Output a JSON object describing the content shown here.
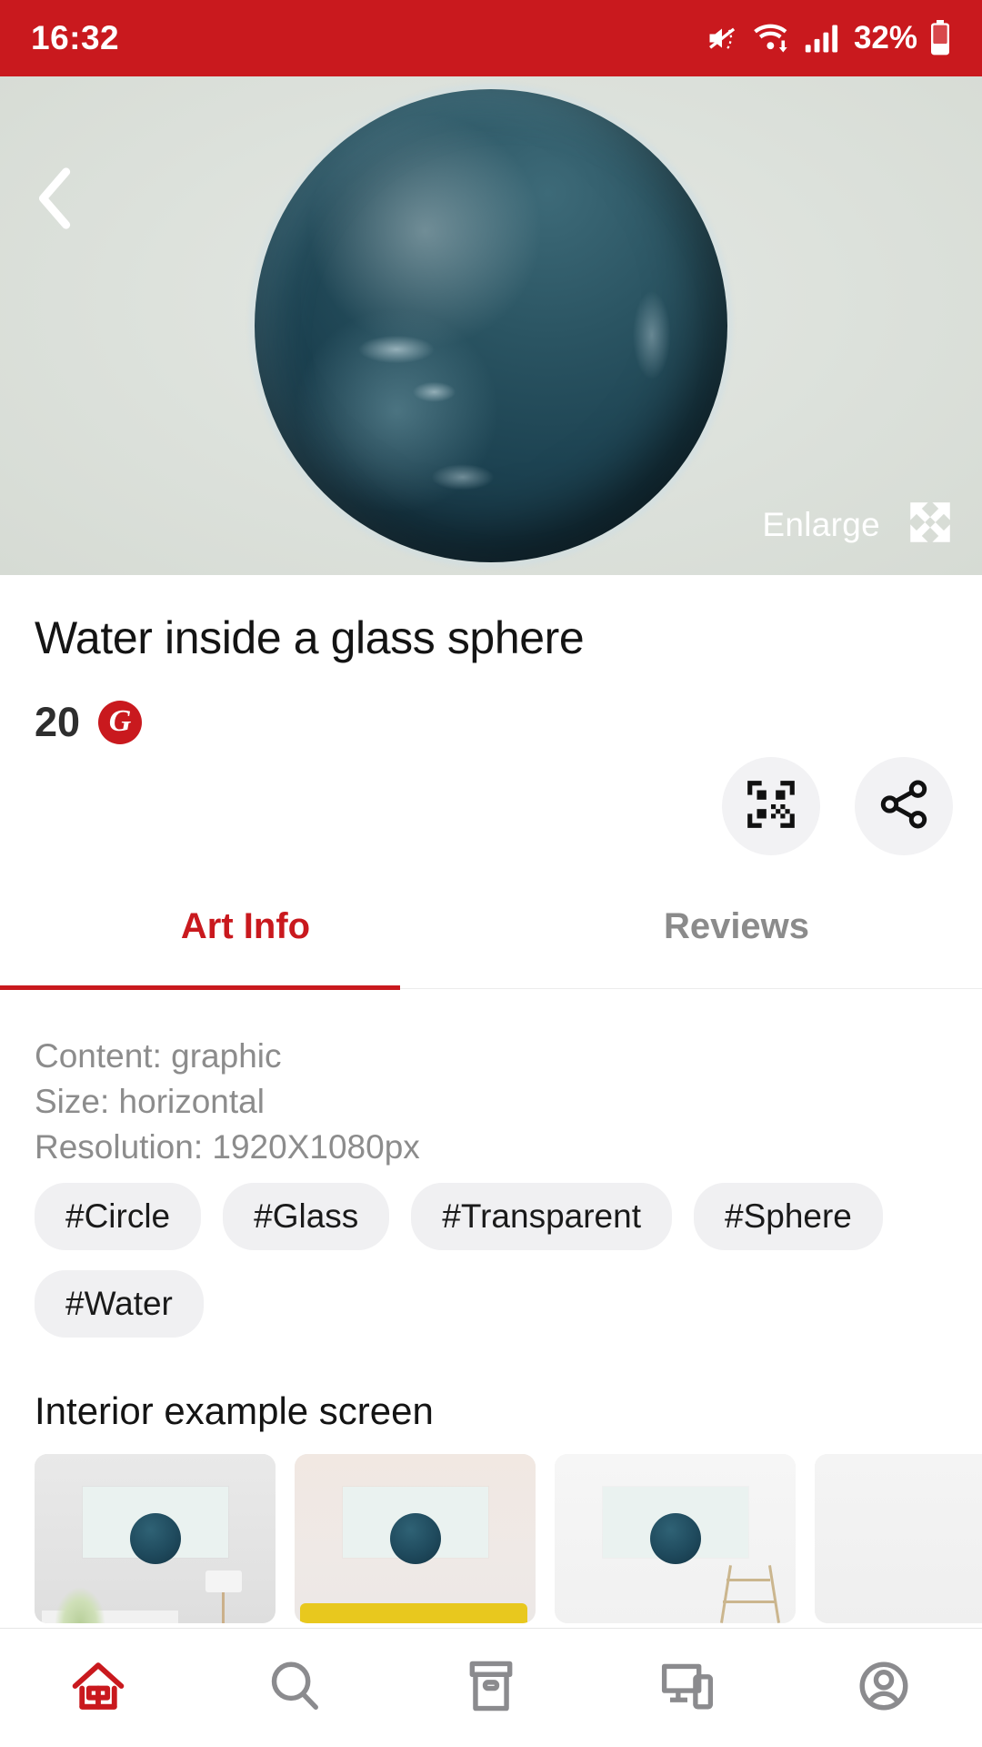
{
  "theme": {
    "brand": "#c9191e",
    "muted": "#8c8c8c",
    "chip_bg": "#f0f0f2"
  },
  "status_bar": {
    "time": "16:32",
    "battery_percent": "32%",
    "icons": [
      "mute-icon",
      "wifi-icon",
      "signal-icon",
      "battery-icon"
    ]
  },
  "hero": {
    "back_icon": "back-chevron-icon",
    "enlarge_label": "Enlarge",
    "enlarge_icon": "expand-icon",
    "artwork_alt": "Water inside a glass sphere"
  },
  "product": {
    "title": "Water inside a glass sphere",
    "price": "20",
    "currency_symbol": "G",
    "currency_icon": "coin-icon"
  },
  "actions": [
    {
      "name": "qr-code-button",
      "icon": "qr-code-icon"
    },
    {
      "name": "share-button",
      "icon": "share-icon"
    }
  ],
  "tabs": [
    {
      "label": "Art Info",
      "active": true
    },
    {
      "label": "Reviews",
      "active": false
    }
  ],
  "art_info": {
    "meta": [
      "Content: graphic",
      "Size: horizontal",
      "Resolution: 1920X1080px"
    ],
    "tags": [
      "#Circle",
      "#Glass",
      "#Transparent",
      "#Sphere",
      "#Water"
    ]
  },
  "interior": {
    "section_title": "Interior example screen",
    "thumbnails": [
      {
        "name": "interior-thumb-1"
      },
      {
        "name": "interior-thumb-2"
      },
      {
        "name": "interior-thumb-3"
      },
      {
        "name": "interior-thumb-4"
      }
    ]
  },
  "bottom_nav": [
    {
      "name": "nav-home",
      "icon": "home-icon",
      "active": true
    },
    {
      "name": "nav-search",
      "icon": "search-icon",
      "active": false
    },
    {
      "name": "nav-archive",
      "icon": "archive-box-icon",
      "active": false
    },
    {
      "name": "nav-devices",
      "icon": "devices-icon",
      "active": false
    },
    {
      "name": "nav-account",
      "icon": "account-icon",
      "active": false
    }
  ]
}
